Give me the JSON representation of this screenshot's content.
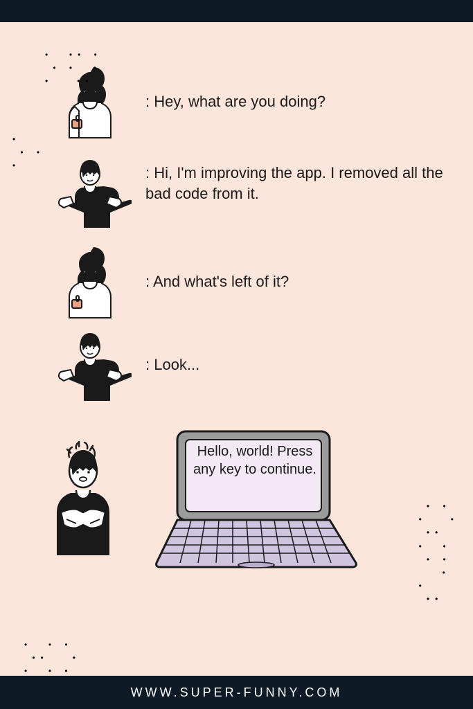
{
  "footer_url": "WWW.SUPER-FUNNY.COM",
  "dialogue": {
    "line1": ": Hey, what are you doing?",
    "line2": ": Hi, I'm improving the app. I removed all the bad code from it.",
    "line3": ": And what's left of it?",
    "line4": ": Look..."
  },
  "laptop_text": "Hello, world! Press any key to continue."
}
